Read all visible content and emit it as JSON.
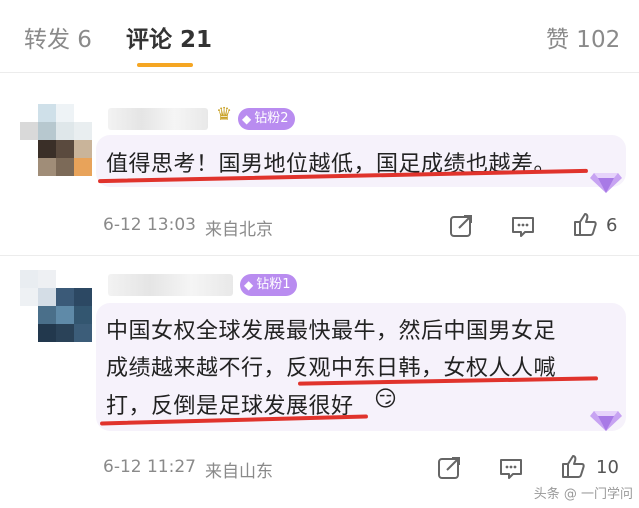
{
  "tabs": [
    {
      "label": "转发 6",
      "active": false
    },
    {
      "label": "评论 21",
      "active": true
    },
    {
      "label": "赞 102",
      "active": false
    }
  ],
  "comments": [
    {
      "user_badge": "钻粉2",
      "text": "值得思考！国男地位越低，国足成绩也越差。",
      "time": "6-12 13:03",
      "location": "来自北京",
      "likes": "6"
    },
    {
      "user_badge": "钻粉1",
      "lines": [
        "中国女权全球发展最快最牛，然后中国男女足",
        "成绩越来越不行，反观中东日韩，女权人人喊",
        "打，反倒是足球发展很好"
      ],
      "emoji": "😏",
      "time": "6-12 11:27",
      "location": "来自山东",
      "likes": "10"
    }
  ],
  "watermark": "头条 @ 一门学问",
  "colors": {
    "accent": "#f5a623",
    "underline_red": "#e0332c",
    "badge": "#b98cf0"
  }
}
